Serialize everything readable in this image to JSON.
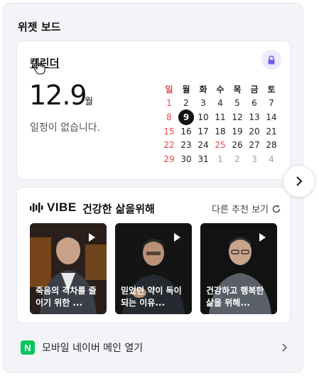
{
  "board": {
    "title": "위젯 보드"
  },
  "calendar": {
    "title": "캘린더",
    "date_value": "12.9",
    "date_unit": "월",
    "empty_text": "일정이 없습니다.",
    "weekdays": [
      "일",
      "월",
      "화",
      "수",
      "목",
      "금",
      "토"
    ],
    "weeks": [
      [
        {
          "d": "1",
          "m": false
        },
        {
          "d": "2",
          "m": false
        },
        {
          "d": "3",
          "m": false
        },
        {
          "d": "4",
          "m": false
        },
        {
          "d": "5",
          "m": false
        },
        {
          "d": "6",
          "m": false
        },
        {
          "d": "7",
          "m": false
        }
      ],
      [
        {
          "d": "8",
          "m": false
        },
        {
          "d": "9",
          "m": false,
          "today": true
        },
        {
          "d": "10",
          "m": false
        },
        {
          "d": "11",
          "m": false
        },
        {
          "d": "12",
          "m": false
        },
        {
          "d": "13",
          "m": false
        },
        {
          "d": "14",
          "m": false
        }
      ],
      [
        {
          "d": "15",
          "m": false
        },
        {
          "d": "16",
          "m": false
        },
        {
          "d": "17",
          "m": false
        },
        {
          "d": "18",
          "m": false
        },
        {
          "d": "19",
          "m": false
        },
        {
          "d": "20",
          "m": false
        },
        {
          "d": "21",
          "m": false
        }
      ],
      [
        {
          "d": "22",
          "m": false
        },
        {
          "d": "23",
          "m": false
        },
        {
          "d": "24",
          "m": false
        },
        {
          "d": "25",
          "m": false,
          "holiday": true
        },
        {
          "d": "26",
          "m": false
        },
        {
          "d": "27",
          "m": false
        },
        {
          "d": "28",
          "m": false
        }
      ],
      [
        {
          "d": "29",
          "m": false
        },
        {
          "d": "30",
          "m": false
        },
        {
          "d": "31",
          "m": false
        },
        {
          "d": "1",
          "m": true
        },
        {
          "d": "2",
          "m": true
        },
        {
          "d": "3",
          "m": true
        },
        {
          "d": "4",
          "m": true
        }
      ]
    ],
    "accent_color": "#7b5cf0",
    "holiday_color": "#e6454d"
  },
  "vibe": {
    "logo_text": "VIBE",
    "title": "건강한 삶을위해",
    "more_label": "다른 추천 보기",
    "videos": [
      {
        "caption": "죽음의 격차를 줄이기 위한 ..."
      },
      {
        "caption": "믿었던 약이 독이 되는 이유..."
      },
      {
        "caption": "건강하고 행복한 삶을 위해..."
      }
    ]
  },
  "footer": {
    "badge": "N",
    "label": "모바일 네이버 메인 열기",
    "badge_color": "#03c75a"
  }
}
